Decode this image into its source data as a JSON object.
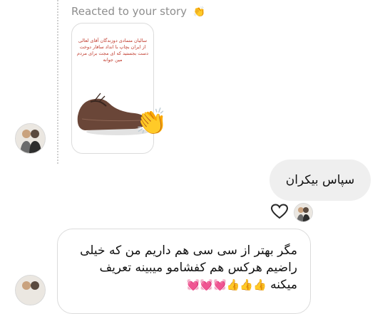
{
  "story_reply": {
    "label": "Reacted to your story",
    "label_emoji": "👏",
    "story_text": "سالیان متمادی دوزندگان آقای لعالی از ایران بچاپ با انداد سافار دوخت دست بجستید که ای مجت برای مردم مین جوانه"
  },
  "reaction_emoji": "👏",
  "messages": {
    "outgoing_text": "سپاس بیکران",
    "incoming_text": "مگر بهتر از سی سی هم داریم من که خیلی راضیم هرکس هم کفشامو میبینه تعریف میکنه",
    "incoming_emojis": "👍👍👍💓💓💓"
  },
  "colors": {
    "meta_text": "#8e8e8e",
    "bubble_gray": "#efefef",
    "border": "#dbdbdb"
  },
  "icons": {
    "like": "heart-icon",
    "avatar": "avatar"
  }
}
